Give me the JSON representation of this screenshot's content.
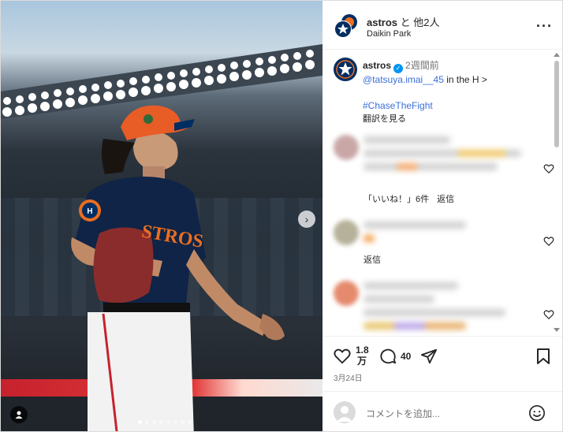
{
  "header": {
    "username": "astros",
    "collab_suffix": " と 他2人",
    "location": "Daikin Park"
  },
  "caption": {
    "username": "astros",
    "time_ago": "2週間前",
    "mention": "@tatsuya.imai__45",
    "text": " in the H >",
    "hashtag": "#ChaseTheFight",
    "translate_link": "翻訳を見る"
  },
  "comments": [
    {
      "likes_label": "「いいね！」6件",
      "reply_label": "返信"
    },
    {
      "reply_label": "返信"
    },
    {}
  ],
  "actions": {
    "like_count": "1.8万",
    "like_count_top": "1.8",
    "like_count_bottom": "万",
    "comment_count": "40",
    "date": "3月24日"
  },
  "add_comment": {
    "placeholder": "コメントを追加..."
  },
  "colors": {
    "link_blue": "#3a6fd8",
    "verified_blue": "#0095f6",
    "astros_navy": "#002d62",
    "astros_orange": "#eb6e1f"
  },
  "icons": {
    "more": "more-options-icon",
    "next": "chevron-right-icon",
    "user_tag": "person-icon",
    "like": "heart-icon",
    "comment": "comment-bubble-icon",
    "share": "paper-plane-icon",
    "save": "bookmark-icon",
    "emoji": "smiley-icon"
  }
}
